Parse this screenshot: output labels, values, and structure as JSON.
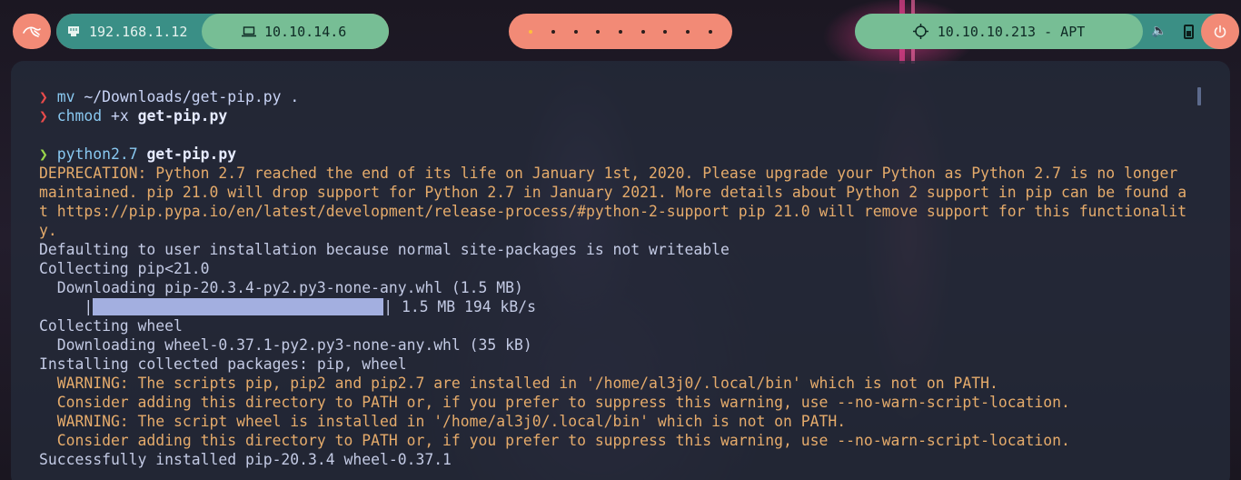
{
  "topbar": {
    "local_ip": "192.168.1.12",
    "vpn_ip": "10.10.14.6",
    "target": "10.10.10.213 - APT",
    "workspaces": 9,
    "active_workspace": 1
  },
  "terminal": {
    "lines": [
      {
        "type": "prompt",
        "status": "error",
        "cmd": "mv",
        "rest": " ~/Downloads/get-pip.py ."
      },
      {
        "type": "prompt",
        "status": "error",
        "cmd": "chmod",
        "rest": " +x ",
        "bold": "get-pip.py"
      },
      {
        "type": "blank"
      },
      {
        "type": "prompt",
        "status": "ok",
        "cmd": "python2.7",
        "rest": " ",
        "bold": "get-pip.py"
      },
      {
        "type": "warn",
        "text": "DEPRECATION: Python 2.7 reached the end of its life on January 1st, 2020. Please upgrade your Python as Python 2.7 is no longer"
      },
      {
        "type": "warn",
        "text": "maintained. pip 21.0 will drop support for Python 2.7 in January 2021. More details about Python 2 support in pip can be found a"
      },
      {
        "type": "warn",
        "text": "t https://pip.pypa.io/en/latest/development/release-process/#python-2-support pip 21.0 will remove support for this functionalit"
      },
      {
        "type": "warn",
        "text": "y."
      },
      {
        "type": "out",
        "text": "Defaulting to user installation because normal site-packages is not writeable"
      },
      {
        "type": "out",
        "text": "Collecting pip<21.0"
      },
      {
        "type": "out",
        "text": "  Downloading pip-20.3.4-py2.py3-none-any.whl (1.5 MB)"
      },
      {
        "type": "progress",
        "prefix": "     |",
        "suffix": "| 1.5 MB 194 kB/s",
        "fraction": 1.0
      },
      {
        "type": "out",
        "text": "Collecting wheel"
      },
      {
        "type": "out",
        "text": "  Downloading wheel-0.37.1-py2.py3-none-any.whl (35 kB)"
      },
      {
        "type": "out",
        "text": "Installing collected packages: pip, wheel"
      },
      {
        "type": "warn",
        "text": "  WARNING: The scripts pip, pip2 and pip2.7 are installed in '/home/al3j0/.local/bin' which is not on PATH."
      },
      {
        "type": "warn",
        "text": "  Consider adding this directory to PATH or, if you prefer to suppress this warning, use --no-warn-script-location."
      },
      {
        "type": "warn",
        "text": "  WARNING: The script wheel is installed in '/home/al3j0/.local/bin' which is not on PATH."
      },
      {
        "type": "warn",
        "text": "  Consider adding this directory to PATH or, if you prefer to suppress this warning, use --no-warn-script-location."
      },
      {
        "type": "out",
        "text": "Successfully installed pip-20.3.4 wheel-0.37.1"
      }
    ]
  }
}
